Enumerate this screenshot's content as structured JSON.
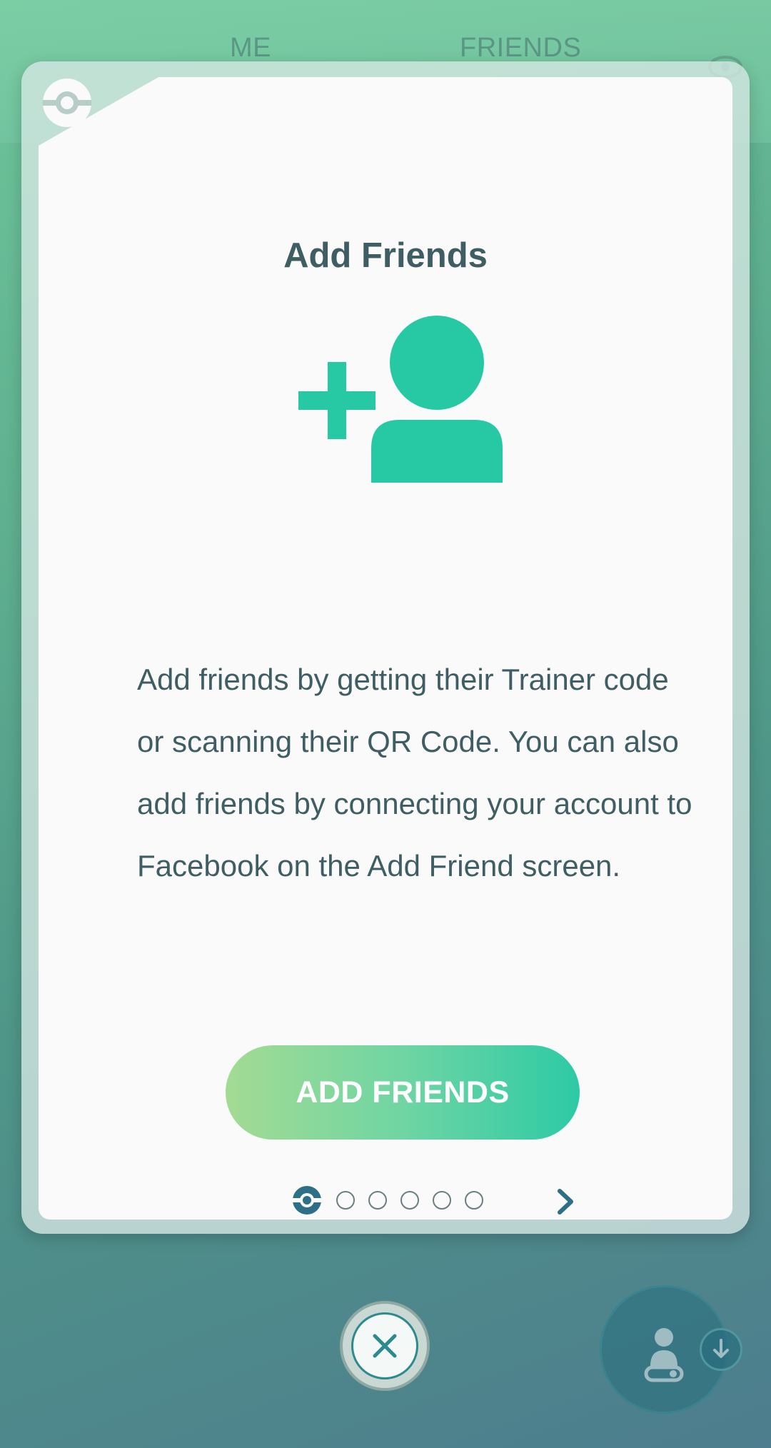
{
  "background": {
    "tabs": [
      {
        "label": "ME"
      },
      {
        "label": "FRIENDS"
      }
    ]
  },
  "modal": {
    "title": "Add Friends",
    "hero_icon": "add-person-icon",
    "body": "Add friends by getting their Trainer code or scanning their QR Code. You can also add friends by connecting your account to Facebook on the Add Friend screen.",
    "primary_button_label": "ADD FRIENDS",
    "pager": {
      "current_page": 1,
      "total_pages": 6
    }
  },
  "colors": {
    "accent_teal": "#26c9a3",
    "text_dark": "#3f5e63",
    "button_gradient_start": "#a3db93",
    "button_gradient_end": "#2dcaa5"
  },
  "icons": {
    "badge": "pokeball-badge-icon",
    "next": "chevron-right-icon",
    "close": "close-icon",
    "corner_action": "trainer-icon",
    "download": "download-icon"
  }
}
